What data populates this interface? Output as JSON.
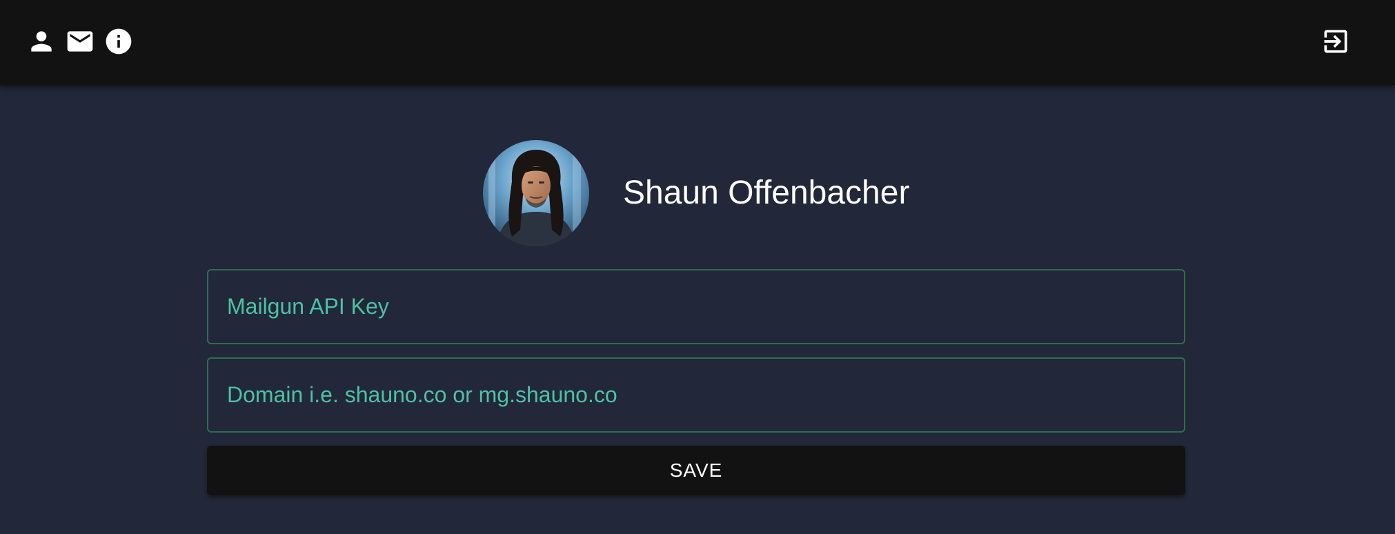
{
  "toolbar": {
    "icons": {
      "profile": "person-icon",
      "mail": "email-icon",
      "info": "info-icon",
      "logout": "logout-icon"
    }
  },
  "profile": {
    "name": "Shaun Offenbacher"
  },
  "form": {
    "api_key": {
      "value": "",
      "placeholder": "Mailgun API Key"
    },
    "domain": {
      "value": "",
      "placeholder": "Domain i.e. shauno.co or mg.shauno.co"
    },
    "save_label": "SAVE"
  },
  "colors": {
    "background": "#222739",
    "toolbar": "#121212",
    "field_border": "#2f6d52",
    "placeholder": "#4cc2a4",
    "text": "#ffffff"
  }
}
